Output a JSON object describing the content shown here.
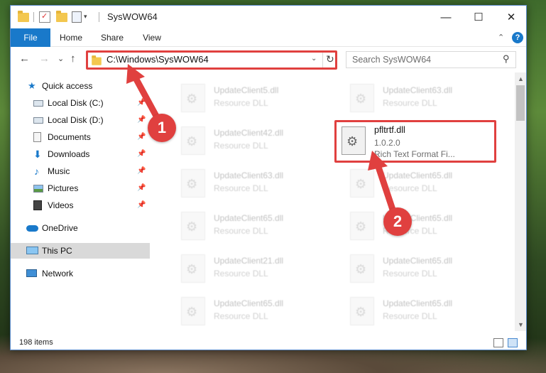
{
  "window": {
    "title": "SysWOW64",
    "minimize": "—",
    "maximize": "☐",
    "close": "✕"
  },
  "ribbon": {
    "tabs": [
      "File",
      "Home",
      "Share",
      "View"
    ],
    "help": "?",
    "collapse": "⌃"
  },
  "nav": {
    "back": "←",
    "forward": "→",
    "recent": "⌄",
    "up": "↑"
  },
  "address": {
    "path": "C:\\Windows\\SysWOW64",
    "dropdown": "⌄",
    "refresh": "↻"
  },
  "search": {
    "placeholder": "Search SysWOW64",
    "icon": "⚲"
  },
  "sidebar": {
    "items": [
      {
        "label": "Quick access",
        "icon": "star-icon",
        "pinned": false
      },
      {
        "label": "Local Disk (C:)",
        "icon": "drive-icon",
        "pinned": true
      },
      {
        "label": "Local Disk (D:)",
        "icon": "drive-icon",
        "pinned": true
      },
      {
        "label": "Documents",
        "icon": "documents-icon",
        "pinned": true
      },
      {
        "label": "Downloads",
        "icon": "downloads-icon",
        "pinned": true
      },
      {
        "label": "Music",
        "icon": "music-icon",
        "pinned": true
      },
      {
        "label": "Pictures",
        "icon": "pictures-icon",
        "pinned": true
      },
      {
        "label": "Videos",
        "icon": "videos-icon",
        "pinned": true
      },
      {
        "label": "OneDrive",
        "icon": "cloud-icon",
        "pinned": false
      },
      {
        "label": "This PC",
        "icon": "computer-icon",
        "pinned": false,
        "selected": true
      },
      {
        "label": "Network",
        "icon": "network-icon",
        "pinned": false
      }
    ],
    "pin_glyph": "📌"
  },
  "files": {
    "left_column": [
      {
        "name": "UpdateClient5.dll",
        "type": "Resource DLL"
      },
      {
        "name": "UpdateClient42.dll",
        "type": "Resource DLL"
      },
      {
        "name": "UpdateClient63.dll",
        "type": "Resource DLL"
      },
      {
        "name": "UpdateClient65.dll",
        "type": "Resource DLL"
      },
      {
        "name": "UpdateClient21.dll",
        "type": "Resource DLL"
      },
      {
        "name": "UpdateClient65.dll",
        "type": "Resource DLL"
      }
    ],
    "right_column": [
      {
        "name": "UpdateClient63.dll",
        "type": "Resource DLL"
      },
      {
        "name": "UpdateClient65.dll",
        "type": "Resource DLL"
      },
      {
        "name": "UpdateClient65.dll",
        "type": "Resource DLL"
      },
      {
        "name": "UpdateClient65.dll",
        "type": "Resource DLL"
      },
      {
        "name": "UpdateClient65.dll",
        "type": "Resource DLL"
      }
    ],
    "highlighted": {
      "name": "pfltrtf.dll",
      "version": "1.0.2.0",
      "description": "Rich Text Format Fi..."
    }
  },
  "status": {
    "item_count": "198 items"
  },
  "callouts": {
    "step1": "1",
    "step2": "2",
    "color": "#e0403f"
  }
}
